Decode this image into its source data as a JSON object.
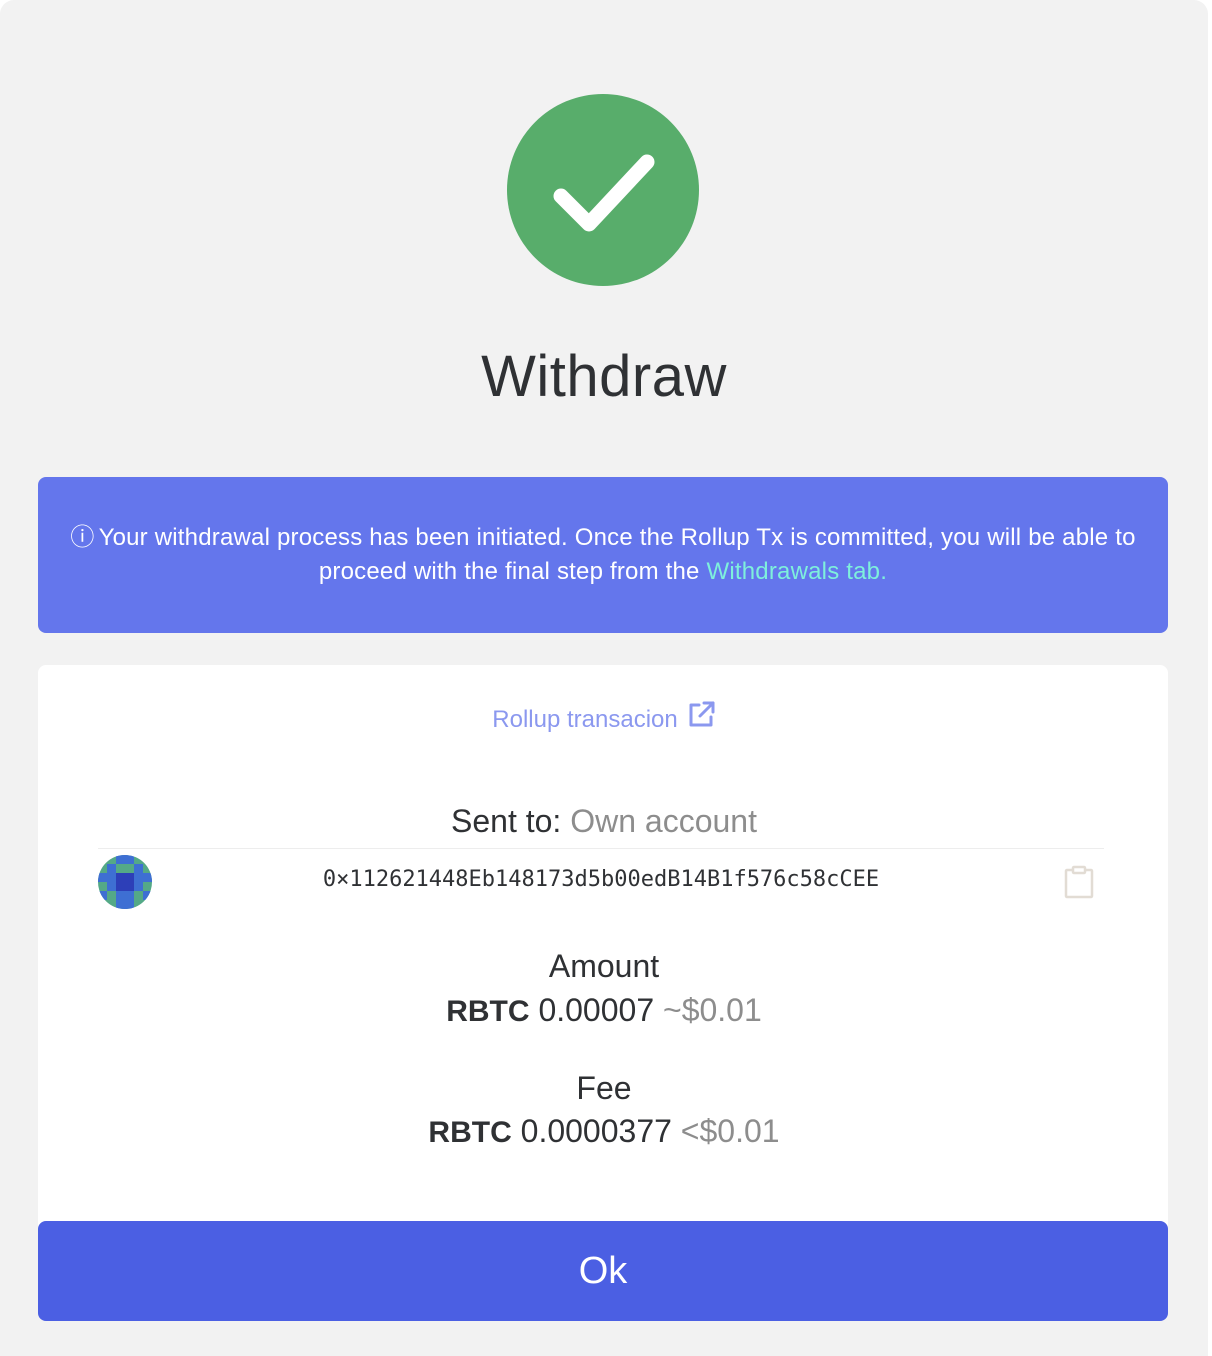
{
  "modal": {
    "title": "Withdraw",
    "success_icon": "check-icon",
    "colors": {
      "success": "#58ad6b",
      "banner": "#6476ec",
      "link": "#7ef0dc",
      "button": "#4b5fe3"
    }
  },
  "banner": {
    "info_glyph": "ⓘ",
    "text": "Your withdrawal process has been initiated. Once the Rollup Tx is committed, you will be able to proceed with the final step from the",
    "link_text": "Withdrawals tab."
  },
  "details": {
    "rollup_link": "Rollup transacion",
    "sent_to_label": "Sent to:",
    "sent_to_value": "Own account",
    "address": "0×112621448Eb148173d5b00edB14B1f576c58cCEE",
    "amount": {
      "label": "Amount",
      "symbol": "RBTC",
      "value": "0.00007",
      "fiat": "~$0.01"
    },
    "fee": {
      "label": "Fee",
      "symbol": "RBTC",
      "value": "0.0000377",
      "fiat": "<$0.01"
    }
  },
  "actions": {
    "ok_label": "Ok"
  }
}
